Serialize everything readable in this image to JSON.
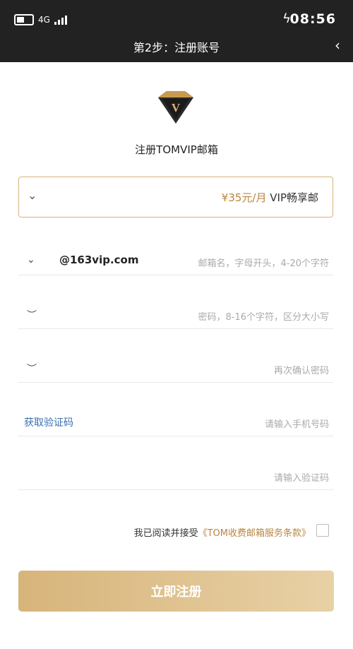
{
  "status_bar": {
    "time": "08:56",
    "network": "4G"
  },
  "header": {
    "title": "第2步：注册账号"
  },
  "brand": {
    "logo_letter": "V",
    "title": "注册TOMVIP邮箱"
  },
  "plan": {
    "price": "¥35元/月",
    "name": "VIP畅享邮"
  },
  "form": {
    "username_placeholder": "邮箱名，字母开头，4-20个字符",
    "domain": "@163vip.com",
    "password_placeholder": "密码，8-16个字符，区分大小写",
    "confirm_placeholder": "再次确认密码",
    "phone_placeholder": "请输入手机号码",
    "get_code_label": "获取验证码",
    "code_placeholder": "请输入验证码"
  },
  "agreement": {
    "text": "我已阅读并接受",
    "link": "《TOM收费邮箱服务条款》"
  },
  "submit": {
    "label": "立即注册"
  },
  "colors": {
    "accent": "#d9b27a",
    "link": "#3b6fb0",
    "topbar": "#222222"
  }
}
